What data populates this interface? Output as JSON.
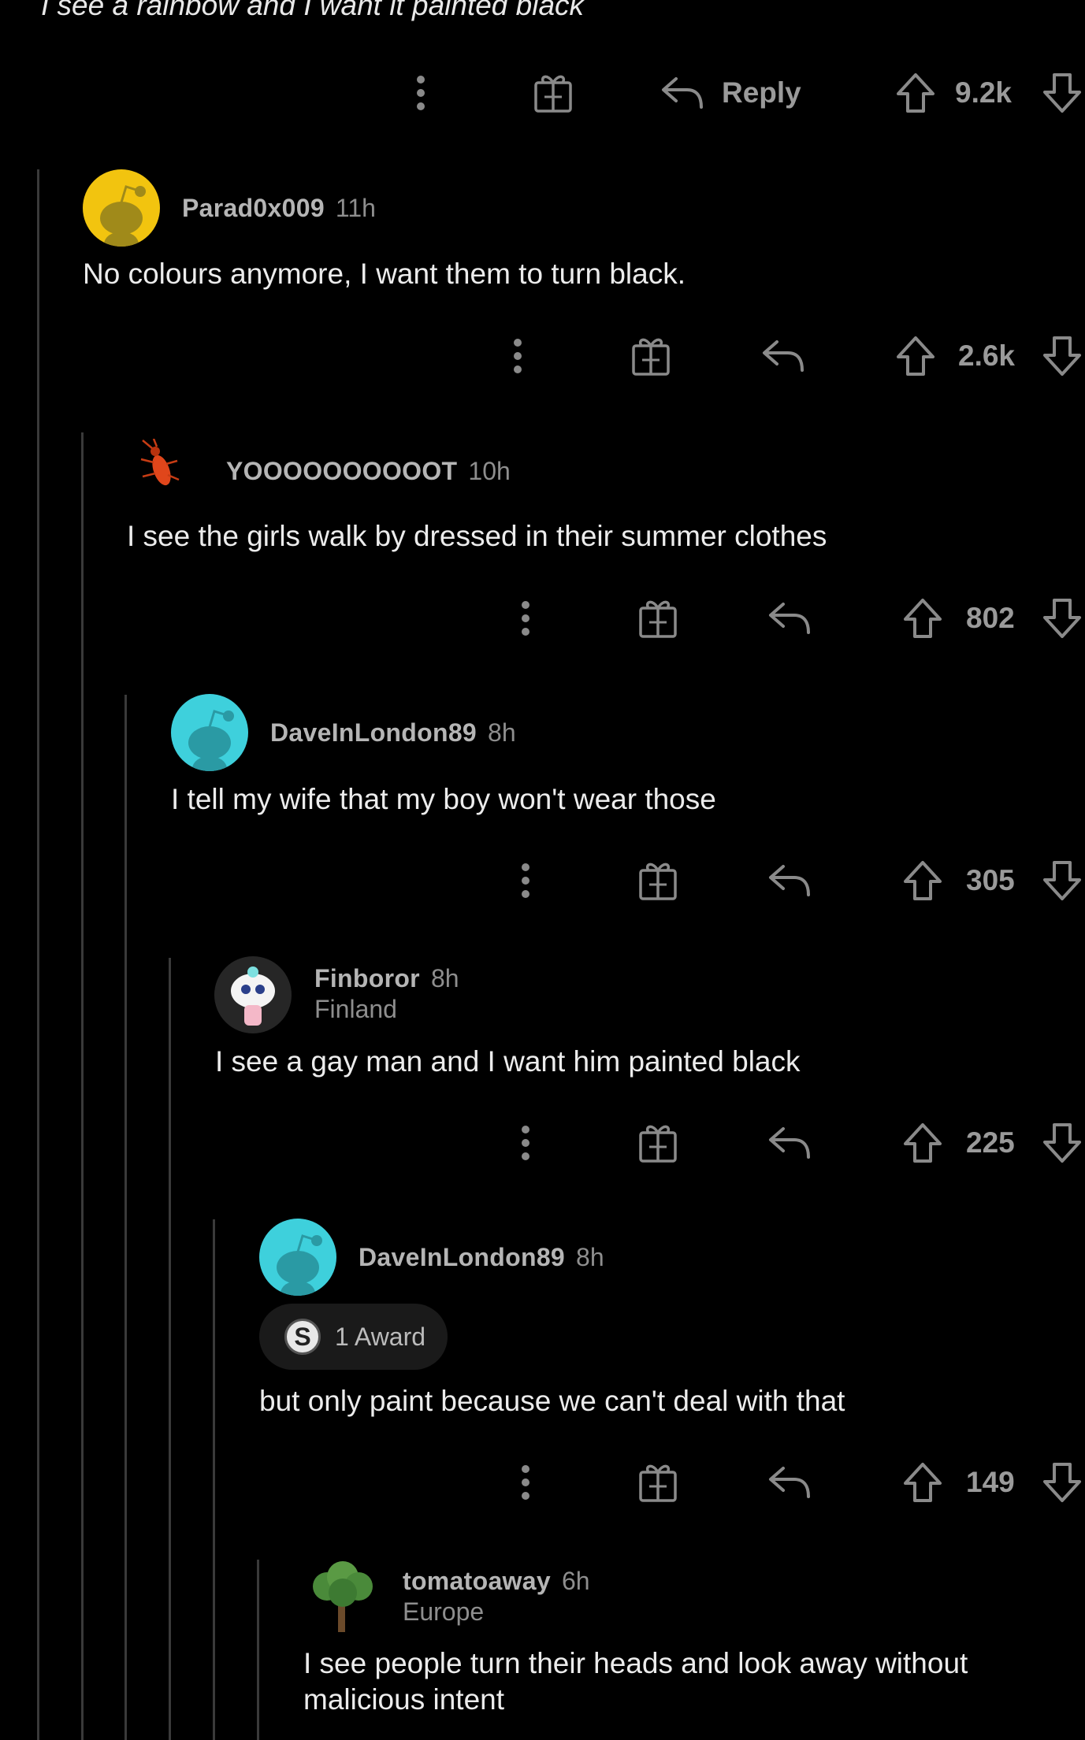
{
  "post_line": "I see a rainbow and I want it painted black",
  "top_actions": {
    "reply_label": "Reply",
    "score": "9.2k"
  },
  "comments": [
    {
      "username": "Parad0x009",
      "time": "11h",
      "location": "",
      "body": "No colours anymore, I want them to turn black.",
      "score": "2.6k",
      "avatar_color": "#f2c40f"
    },
    {
      "username": "YOOOOOOOOOOT",
      "time": "10h",
      "location": "",
      "body": "I see the girls walk by dressed in their summer clothes",
      "score": "802",
      "avatar_color": "#e0461b"
    },
    {
      "username": "DaveInLondon89",
      "time": "8h",
      "location": "",
      "body": "I tell my wife that my boy won't wear those",
      "score": "305",
      "avatar_color": "#3ed0dc"
    },
    {
      "username": "Finboror",
      "time": "8h",
      "location": "Finland",
      "body": "I see a gay man and I want him painted black",
      "score": "225",
      "avatar_color": "#ffffff"
    },
    {
      "username": "DaveInLondon89",
      "time": "8h",
      "location": "",
      "award": "1 Award",
      "body": "but only paint because we can't deal with that",
      "score": "149",
      "avatar_color": "#3ed0dc"
    },
    {
      "username": "tomatoaway",
      "time": "6h",
      "location": "Europe",
      "body": "I see people turn their heads and look away without malicious intent",
      "score": "",
      "avatar_color": "#4a8a3a"
    }
  ],
  "icons": [
    "more-icon",
    "gift-icon",
    "reply-icon",
    "upvote-icon",
    "downvote-icon",
    "snoo-avatar-icon",
    "award-icon"
  ]
}
